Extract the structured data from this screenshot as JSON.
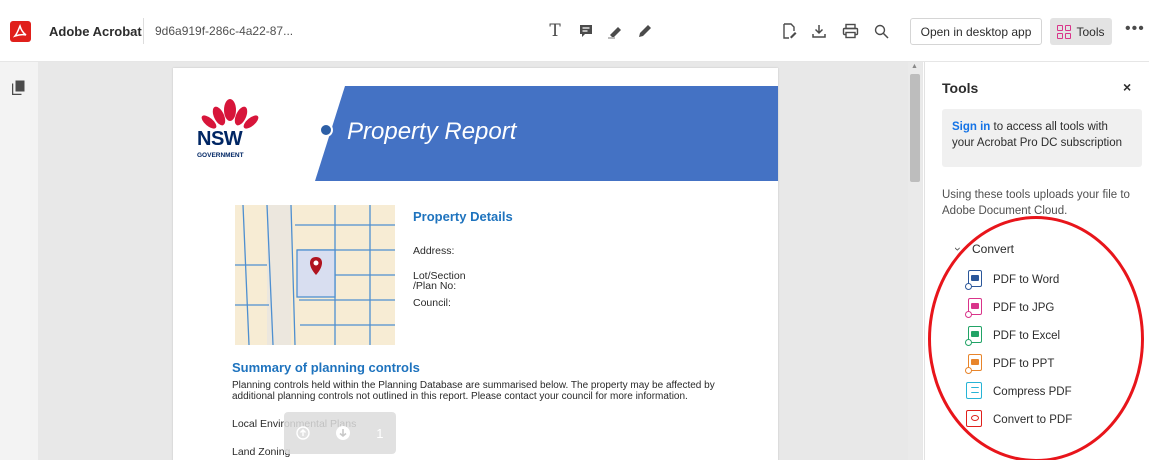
{
  "header": {
    "app_name": "Adobe Acrobat",
    "doc_name": "9d6a919f-286c-4a22-87...",
    "text_tool_glyph": "T",
    "open_desktop_label": "Open in desktop app",
    "tools_label": "Tools",
    "more_glyph": "•••"
  },
  "document": {
    "nsw_wordmark": "NSW",
    "government_wordmark": "GOVERNMENT",
    "report_title": "Property Report",
    "property_details_title": "Property Details",
    "address_label": "Address:",
    "lot_label_line1": "Lot/Section",
    "lot_label_line2": "/Plan No:",
    "council_label": "Council:",
    "summary_title": "Summary of planning controls",
    "summary_body": "Planning controls held within the Planning Database are summarised below. The property may be affected by additional planning controls not outlined in this report. Please contact your council for more information.",
    "lep_label": "Local Environmental Plans",
    "land_zoning_label": "Land Zoning",
    "page_number": "1"
  },
  "tools_panel": {
    "title": "Tools",
    "close_glyph": "×",
    "signin_link": "Sign in",
    "signin_rest": " to access all tools with your Acrobat Pro DC subscription",
    "upload_note": "Using these tools uploads your file to Adobe Document Cloud.",
    "convert_chevron": "›",
    "convert_label": "Convert",
    "items": [
      {
        "label": "PDF to Word",
        "icon": "pdf-to-word-icon",
        "color": "#2b579a"
      },
      {
        "label": "PDF to JPG",
        "icon": "pdf-to-jpg-icon",
        "color": "#d9348a"
      },
      {
        "label": "PDF to Excel",
        "icon": "pdf-to-excel-icon",
        "color": "#21a366"
      },
      {
        "label": "PDF to PPT",
        "icon": "pdf-to-ppt-icon",
        "color": "#e8852b"
      },
      {
        "label": "Compress PDF",
        "icon": "compress-pdf-icon",
        "color": "#27b4d6"
      },
      {
        "label": "Convert to PDF",
        "icon": "convert-to-pdf-icon",
        "color": "#e0201b"
      }
    ]
  },
  "colors": {
    "acrobat_red": "#e0201b",
    "banner_blue": "#4472c4",
    "heading_blue": "#1e73be",
    "link_blue": "#1473e6",
    "annotation_red": "#e8151b"
  }
}
